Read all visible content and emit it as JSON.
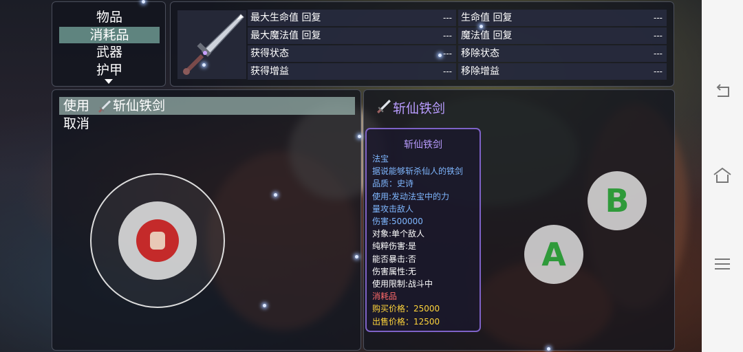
{
  "category": {
    "items": [
      {
        "label": "物品",
        "selected": false
      },
      {
        "label": "消耗品",
        "selected": true
      },
      {
        "label": "武器",
        "selected": false
      },
      {
        "label": "护甲",
        "selected": false
      }
    ]
  },
  "effects": {
    "item_icon": "sword-icon",
    "rows": [
      [
        {
          "label": "最大生命值 回复",
          "value": "---"
        },
        {
          "label": "生命值 回复",
          "value": "---"
        }
      ],
      [
        {
          "label": "最大魔法值 回复",
          "value": "---"
        },
        {
          "label": "魔法值 回复",
          "value": "---"
        }
      ],
      [
        {
          "label": "获得状态",
          "value": "---"
        },
        {
          "label": "移除状态",
          "value": "---"
        }
      ],
      [
        {
          "label": "获得增益",
          "value": "---"
        },
        {
          "label": "移除增益",
          "value": "---"
        }
      ]
    ]
  },
  "commands": {
    "use_prefix": "使用",
    "use_item": "斩仙铁剑",
    "cancel": "取消"
  },
  "detail": {
    "name": "斩仙铁剑",
    "card": {
      "title": "斩仙铁剑",
      "lines": [
        {
          "text": "法宝",
          "color": "#7fb7ff"
        },
        {
          "text": "据说能够斩杀仙人的铁剑",
          "color": "#7fb7ff"
        },
        {
          "text": "品质：史诗",
          "color": "#7fb7ff"
        },
        {
          "text": "使用:发动法宝中的力",
          "color": "#7fb7ff"
        },
        {
          "text": "量攻击敌人",
          "color": "#7fb7ff"
        },
        {
          "text": "伤害:500000",
          "color": "#7fb7ff"
        },
        {
          "text": "对象:单个敌人",
          "color": "#ffffff"
        },
        {
          "text": "纯粹伤害:是",
          "color": "#ffffff"
        },
        {
          "text": "能否暴击:否",
          "color": "#ffffff"
        },
        {
          "text": "伤害属性:无",
          "color": "#ffffff"
        },
        {
          "text": "使用限制:战斗中",
          "color": "#ffffff"
        },
        {
          "text": "消耗品",
          "color": "#ff6a6a"
        },
        {
          "text": "购买价格：25000",
          "color": "#ffd43b"
        },
        {
          "text": "出售价格：12500",
          "color": "#ffd43b"
        }
      ]
    }
  },
  "controls": {
    "button_a": "A",
    "button_b": "B",
    "joystick_icon": "hero-avatar-icon"
  },
  "navbar": {
    "back_icon": "back-icon",
    "home_icon": "home-icon",
    "menu_icon": "menu-icon"
  }
}
